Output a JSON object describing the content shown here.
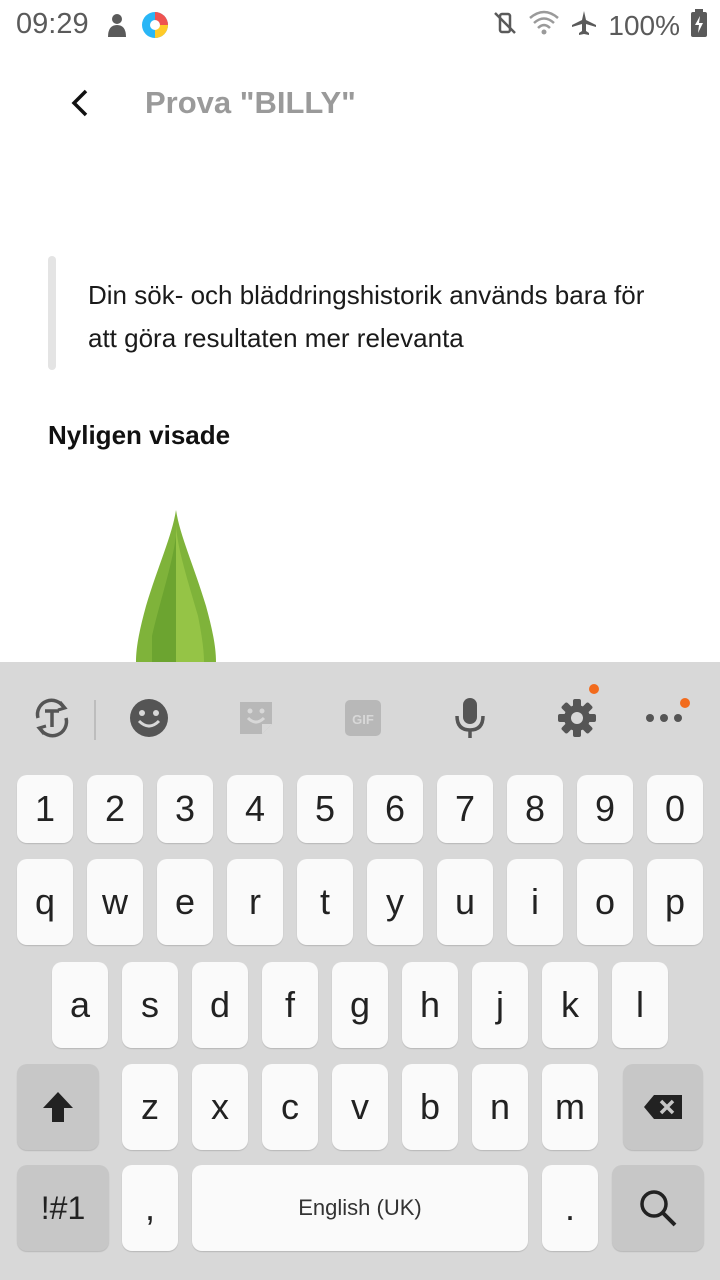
{
  "status_bar": {
    "time": "09:29",
    "battery": "100%"
  },
  "search": {
    "query": "Prova \"BILLY\""
  },
  "info": {
    "text": "Din sök- och bläddringshistorik används bara för att göra resultaten mer relevanta"
  },
  "recent": {
    "title": "Nyligen visade"
  },
  "keyboard": {
    "numbers": [
      "1",
      "2",
      "3",
      "4",
      "5",
      "6",
      "7",
      "8",
      "9",
      "0"
    ],
    "row1": [
      "q",
      "w",
      "e",
      "r",
      "t",
      "y",
      "u",
      "i",
      "o",
      "p"
    ],
    "row2": [
      "a",
      "s",
      "d",
      "f",
      "g",
      "h",
      "j",
      "k",
      "l"
    ],
    "row3": [
      "z",
      "x",
      "c",
      "v",
      "b",
      "n",
      "m"
    ],
    "symbols_label": "!#1",
    "comma": ",",
    "space_label": "English (UK)",
    "period": ".",
    "gif_label": "GIF"
  },
  "colors": {
    "accent_dot": "#f26b1d",
    "keyboard_bg": "#d8d8d8"
  }
}
